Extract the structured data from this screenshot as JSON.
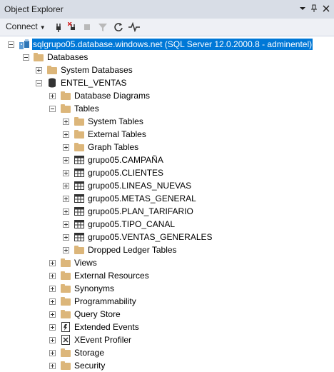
{
  "window": {
    "title": "Object Explorer",
    "pin_icon": "pin-icon",
    "dropdown_icon": "window-position-icon",
    "close_icon": "close-icon"
  },
  "toolbar": {
    "connect_label": "Connect",
    "tools": [
      "connect-object-explorer-icon",
      "disconnect-icon",
      "stop-icon",
      "filter-icon",
      "refresh-icon",
      "activity-monitor-icon"
    ]
  },
  "tree": {
    "server": "sqlgrupo05.database.windows.net (SQL Server 12.0.2000.8 - adminentel)",
    "databases": "Databases",
    "system_databases": "System Databases",
    "database_name": "ENTEL_VENTAS",
    "diagrams": "Database Diagrams",
    "tables": "Tables",
    "system_tables": "System Tables",
    "external_tables": "External Tables",
    "graph_tables": "Graph Tables",
    "table_items": [
      "grupo05.CAMPAÑA",
      "grupo05.CLIENTES",
      "grupo05.LINEAS_NUEVAS",
      "grupo05.METAS_GENERAL",
      "grupo05.PLAN_TARIFARIO",
      "grupo05.TIPO_CANAL",
      "grupo05.VENTAS_GENERALES"
    ],
    "dropped_ledger": "Dropped Ledger Tables",
    "db_children": [
      "Views",
      "External Resources",
      "Synonyms",
      "Programmability",
      "Query Store",
      "Extended Events",
      "XEvent Profiler",
      "Storage",
      "Security"
    ]
  }
}
